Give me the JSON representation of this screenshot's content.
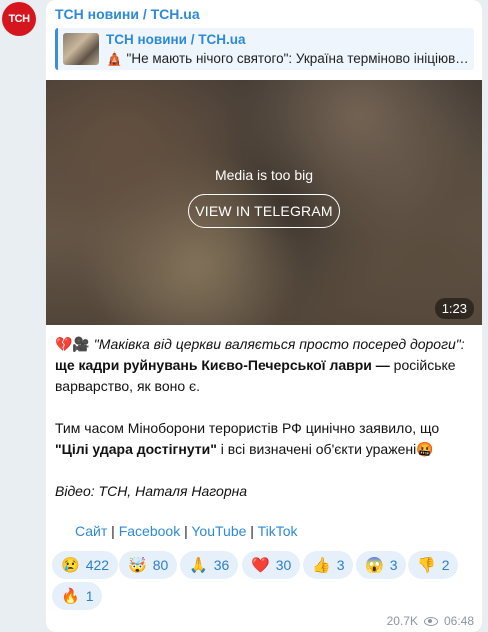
{
  "channel": {
    "avatar_text": "TCH",
    "name": "ТСН новини / TCH.ua"
  },
  "forward": {
    "title": "ТСН новини / TCH.ua",
    "text": "🛕 \"Не мають нічого святого\": Україна терміново ініціювала засідання Ради безпеки ООН"
  },
  "media": {
    "message": "Media is too big",
    "button": "VIEW IN TELEGRAM",
    "duration": "1:23"
  },
  "post": {
    "l1_emoji": "💔🎥",
    "l1_quote": "\"Маківка від церкви валяється просто посеред дороги\":",
    "l2_bold": "ще кадри руйнувань Києво-Печерської лаври —",
    "l2_rest": " російське",
    "l3": "варварство, як воно є.",
    "l4": "Тим часом Міноборони терористів РФ цинічно заявило, що",
    "l5_bold": "\"Цілі удара достігнути\"",
    "l5_rest": " і всі визначені об'єкти уражені🤬",
    "l6": "Відео: ТСН, Наталя Нагорна"
  },
  "links": {
    "site": "Сайт",
    "sep": " | ",
    "facebook": "Facebook",
    "youtube": "YouTube",
    "tiktok": "TikTok"
  },
  "reactions": [
    {
      "emoji": "😢",
      "count": "422"
    },
    {
      "emoji": "🤯",
      "count": "80"
    },
    {
      "emoji": "🙏",
      "count": "36"
    },
    {
      "emoji": "❤️",
      "count": "30"
    },
    {
      "emoji": "👍",
      "count": "3"
    },
    {
      "emoji": "😱",
      "count": "3"
    },
    {
      "emoji": "👎",
      "count": "2"
    },
    {
      "emoji": "🔥",
      "count": "1"
    }
  ],
  "meta": {
    "views": "20.7K",
    "time": "06:48"
  },
  "colors": {
    "brand": "#d5161e",
    "link": "#2d8ad8",
    "reaction_bg": "#e6f0fa"
  }
}
